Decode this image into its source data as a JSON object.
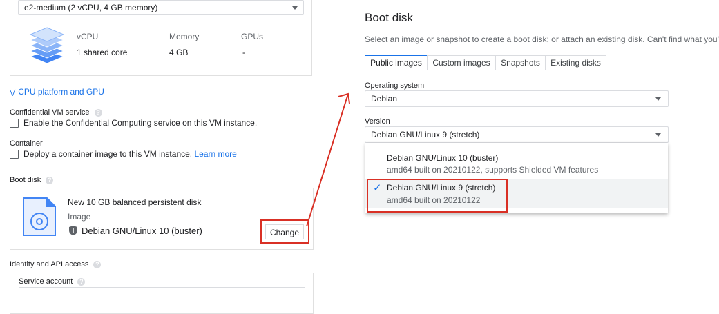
{
  "machine": {
    "type_value": "e2-medium (2 vCPU, 4 GB memory)",
    "vcpu_label": "vCPU",
    "vcpu_value": "1 shared core",
    "memory_label": "Memory",
    "memory_value": "4 GB",
    "gpus_label": "GPUs",
    "gpus_value": "-"
  },
  "cpu_platform_link": "CPU platform and GPU",
  "confidential": {
    "title": "Confidential VM service",
    "checkbox_label": "Enable the Confidential Computing service on this VM instance."
  },
  "container": {
    "title": "Container",
    "checkbox_label": "Deploy a container image to this VM instance.",
    "learn_more": "Learn more"
  },
  "boot_disk_left": {
    "title": "Boot disk",
    "disk_desc": "New 10 GB balanced persistent disk",
    "image_label": "Image",
    "image_value": "Debian GNU/Linux 10 (buster)",
    "change_button": "Change"
  },
  "identity": {
    "title": "Identity and API access",
    "service_account": "Service account"
  },
  "boot_disk_panel": {
    "title": "Boot disk",
    "description": "Select an image or snapshot to create a boot disk; or attach an existing disk. Can't find what you'r",
    "tabs": [
      "Public images",
      "Custom images",
      "Snapshots",
      "Existing disks"
    ],
    "os_label": "Operating system",
    "os_value": "Debian",
    "version_label": "Version",
    "version_value": "Debian GNU/Linux 9 (stretch)",
    "options": [
      {
        "name": "Debian GNU/Linux 10 (buster)",
        "detail": "amd64 built on 20210122, supports Shielded VM features"
      },
      {
        "name": "Debian GNU/Linux 9 (stretch)",
        "detail": "amd64 built on 20210122"
      }
    ]
  },
  "colors": {
    "link": "#1a73e8",
    "annotation_red": "#d93025",
    "selected_bg": "#f1f3f4"
  },
  "icons": [
    "stack-layers-icon",
    "chevron-double-down-icon",
    "help-icon",
    "disk-file-icon",
    "shield-icon",
    "checkmark-icon",
    "dropdown-caret-icon"
  ]
}
